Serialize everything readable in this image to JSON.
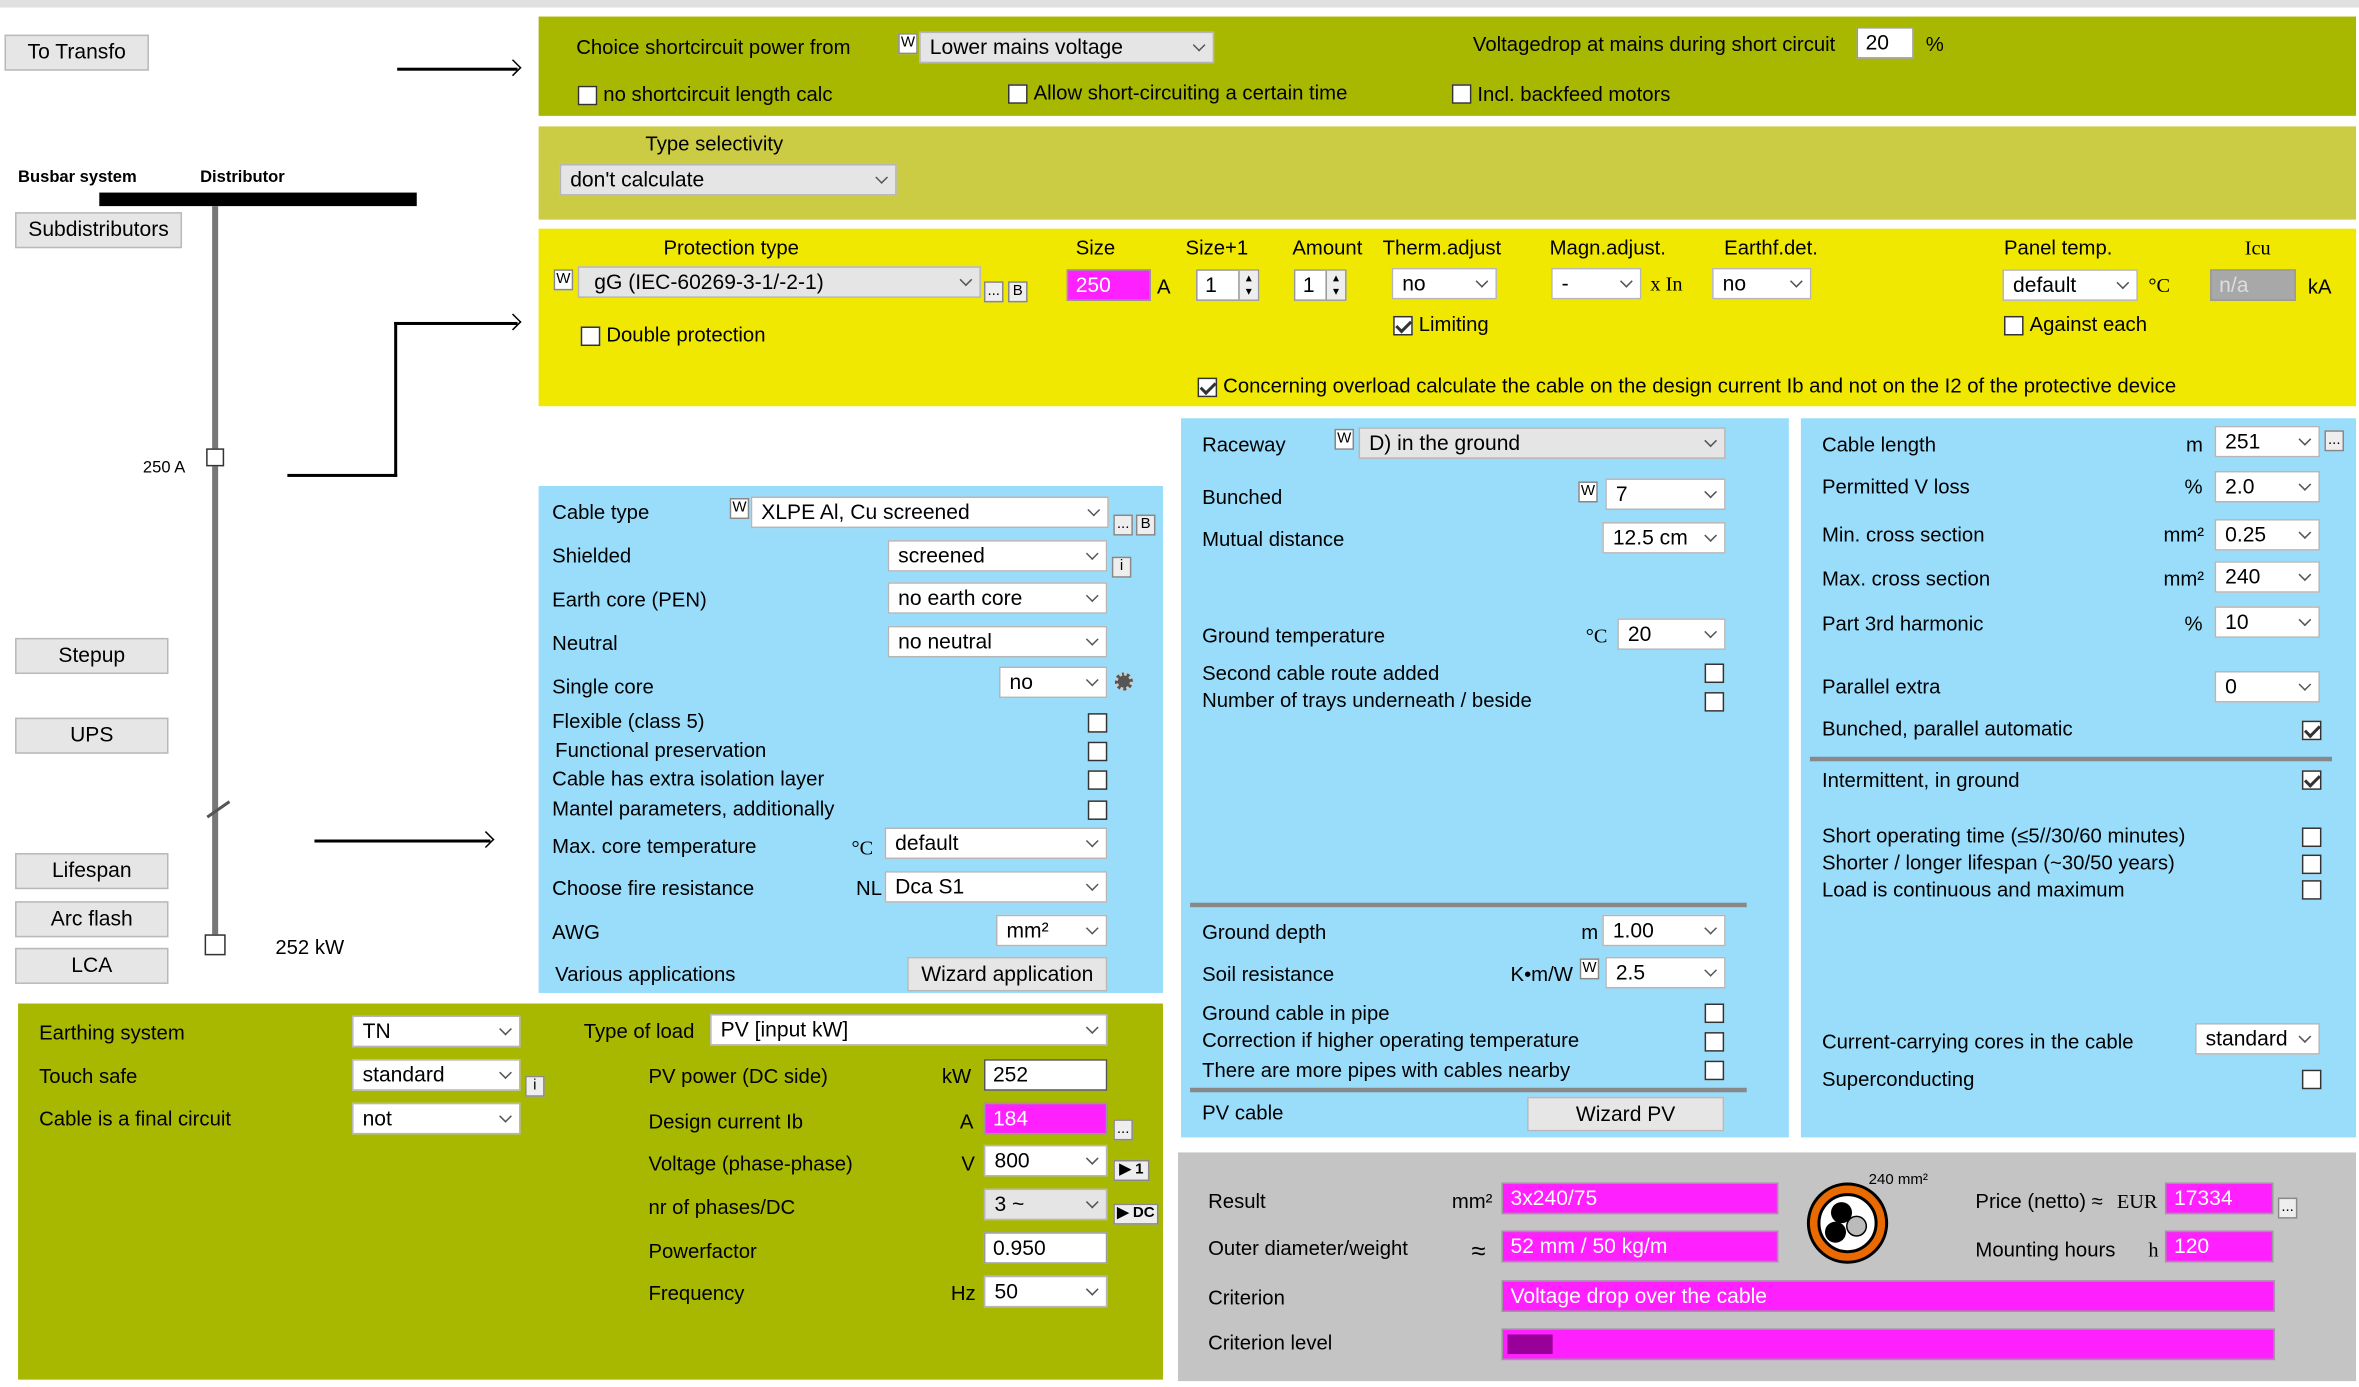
{
  "left": {
    "to_transfo": "To Transfo",
    "busbar_system": "Busbar system",
    "distributor": "Distributor",
    "subdistributors": "Subdistributors",
    "current_label": "250 A",
    "stepup": "Stepup",
    "ups": "UPS",
    "lifespan": "Lifespan",
    "arc_flash": "Arc flash",
    "lca": "LCA",
    "power_label": "252 kW"
  },
  "shortcircuit": {
    "choice_label": "Choice shortcircuit power from",
    "choice_value": "Lower mains voltage",
    "vdrop_label": "Voltagedrop at mains during short circuit",
    "vdrop_value": "20",
    "vdrop_unit": "%",
    "no_length_calc": "no shortcircuit length calc",
    "allow_time": "Allow short-circuiting a certain time",
    "incl_backfeed": "Incl. backfeed motors"
  },
  "selectivity": {
    "label": "Type selectivity",
    "value": "don't calculate"
  },
  "protection": {
    "type_label": "Protection type",
    "type_value": "gG (IEC-60269-3-1/-2-1)",
    "size_label": "Size",
    "size_value": "250",
    "size_unit": "A",
    "size1_label": "Size+1",
    "size1_value": "1",
    "amount_label": "Amount",
    "amount_value": "1",
    "therm_label": "Therm.adjust",
    "therm_value": "no",
    "magn_label": "Magn.adjust.",
    "magn_value": "-",
    "magn_unit": "x In",
    "earth_label": "Earthf.det.",
    "earth_value": "no",
    "panel_label": "Panel temp.",
    "panel_value": "default",
    "panel_unit": "°C",
    "icu_label": "Icu",
    "icu_value": "n/a",
    "icu_unit": "kA",
    "limiting": "Limiting",
    "against_each": "Against each",
    "double_protection": "Double protection",
    "overload_text": "Concerning overload calculate the cable on the design current Ib and not on the I2 of the protective device",
    "b": "B",
    "dots": "..."
  },
  "cable": {
    "type_label": "Cable type",
    "type_value": "XLPE Al, Cu screened",
    "shielded_label": "Shielded",
    "shielded_value": "screened",
    "earth_label": "Earth core (PEN)",
    "earth_value": "no earth core",
    "neutral_label": "Neutral",
    "neutral_value": "no neutral",
    "single_label": "Single core",
    "single_value": "no",
    "flexible": "Flexible (class 5)",
    "functional": "Functional preservation",
    "extra_isolation": "Cable has extra isolation layer",
    "mantel": "Mantel parameters, additionally",
    "maxcore_label": "Max. core temperature",
    "maxcore_unit": "°C",
    "maxcore_value": "default",
    "fire_label": "Choose fire resistance",
    "fire_unit": "NL",
    "fire_value": "Dca S1",
    "awg_label": "AWG",
    "awg_value": "mm²",
    "various_label": "Various applications",
    "wizard_app": "Wizard application",
    "info": "i"
  },
  "raceway": {
    "raceway_label": "Raceway",
    "raceway_value": "D)  in the ground",
    "bunched_label": "Bunched",
    "bunched_value": "7",
    "mutual_label": "Mutual distance",
    "mutual_value": "12.5 cm",
    "gtemp_label": "Ground temperature",
    "gtemp_unit": "°C",
    "gtemp_value": "20",
    "second_route": "Second cable route added",
    "trays": "Number of trays underneath / beside",
    "gdepth_label": "Ground depth",
    "gdepth_unit": "m",
    "gdepth_value": "1.00",
    "soil_label": "Soil resistance",
    "soil_unit": "K•m/W",
    "soil_value": "2.5",
    "pipe": "Ground cable in pipe",
    "correction": "Correction if higher operating temperature",
    "more_pipes": "There are more pipes with cables nearby",
    "pv_cable": "PV cable",
    "wizard_pv": "Wizard PV"
  },
  "length": {
    "length_label": "Cable length",
    "length_unit": "m",
    "length_value": "251",
    "vloss_label": "Permitted V loss",
    "vloss_unit": "%",
    "vloss_value": "2.0",
    "min_label": "Min. cross section",
    "min_unit": "mm²",
    "min_value": "0.25",
    "max_label": "Max. cross section",
    "max_unit": "mm²",
    "max_value": "240",
    "h3_label": "Part 3rd harmonic",
    "h3_unit": "%",
    "h3_value": "10",
    "parallel_label": "Parallel extra",
    "parallel_value": "0",
    "bunched_auto": "Bunched, parallel automatic",
    "intermittent": "Intermittent, in ground",
    "short_time": "Short operating time (≤5//30/60 minutes)",
    "lifespan": "Shorter / longer lifespan (~30/50 years)",
    "continuous": "Load is continuous and maximum",
    "cores_label": "Current-carrying cores in the cable",
    "cores_value": "standard",
    "superconducting": "Superconducting"
  },
  "load": {
    "earthing_label": "Earthing system",
    "earthing_value": "TN",
    "touch_label": "Touch safe",
    "touch_value": "standard",
    "final_label": "Cable is a final circuit",
    "final_value": "not",
    "type_label": "Type of load",
    "type_value": "PV [input kW]",
    "pv_label": "PV power (DC side)",
    "pv_unit": "kW",
    "pv_value": "252",
    "ib_label": "Design current Ib",
    "ib_unit": "A",
    "ib_value": "184",
    "volt_label": "Voltage (phase-phase)",
    "volt_unit": "V",
    "volt_value": "800",
    "phases_label": "nr of phases/DC",
    "phases_value": "3 ~",
    "pf_label": "Powerfactor",
    "pf_value": "0.950",
    "freq_label": "Frequency",
    "freq_unit": "Hz",
    "freq_value": "50",
    "btn1": "▶ 1",
    "btndc": "▶ DC"
  },
  "result": {
    "result_label": "Result",
    "result_unit": "mm²",
    "result_value": "3x240/75",
    "od_label": "Outer diameter/weight",
    "od_unit": "≈",
    "od_value": "52 mm / 50 kg/m",
    "cross_label": "240 mm²",
    "price_label": "Price (netto) ≈",
    "price_unit": "EUR",
    "price_value": "17334",
    "hours_label": "Mounting hours",
    "hours_unit": "h",
    "hours_value": "120",
    "criterion_label": "Criterion",
    "criterion_value": "Voltage drop over the cable",
    "level_label": "Criterion level",
    "level_fraction": 0.06
  },
  "colors": {
    "olive": "#a8b800",
    "khaki": "#cccc44",
    "yellow": "#f0e800",
    "blue": "#99ddfb",
    "gray": "#c4c4c4",
    "magenta": "#ff20ff"
  }
}
